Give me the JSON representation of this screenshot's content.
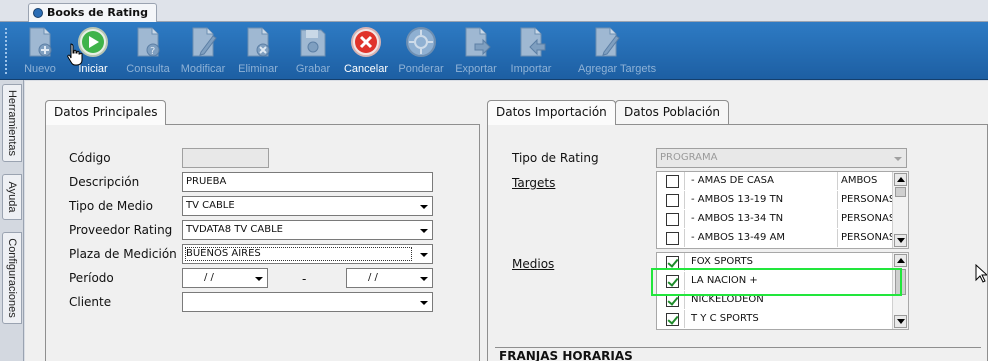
{
  "window": {
    "tab_title": "Books de Rating"
  },
  "toolbar": {
    "buttons": [
      {
        "label": "Nuevo",
        "enabled": false,
        "icon": "new-document-icon"
      },
      {
        "label": "Iniciar",
        "enabled": true,
        "icon": "play-icon"
      },
      {
        "label": "Consulta",
        "enabled": false,
        "icon": "query-document-icon"
      },
      {
        "label": "Modificar",
        "enabled": false,
        "icon": "edit-document-icon"
      },
      {
        "label": "Eliminar",
        "enabled": false,
        "icon": "delete-document-icon"
      },
      {
        "label": "Grabar",
        "enabled": false,
        "icon": "save-icon"
      },
      {
        "label": "Cancelar",
        "enabled": true,
        "icon": "cancel-icon"
      },
      {
        "label": "Ponderar",
        "enabled": false,
        "icon": "weigh-icon"
      },
      {
        "label": "Exportar",
        "enabled": false,
        "icon": "export-document-icon"
      },
      {
        "label": "Importar",
        "enabled": false,
        "icon": "import-document-icon"
      },
      {
        "label": "Agregar Targets",
        "enabled": false,
        "icon": "add-targets-icon"
      }
    ]
  },
  "side_tabs": [
    "Herramientas",
    "Ayuda",
    "Configuraciones"
  ],
  "left_panel": {
    "tab": "Datos Principales",
    "fields": {
      "codigo": {
        "label": "Código",
        "value": ""
      },
      "descripcion": {
        "label": "Descripción",
        "value": "PRUEBA"
      },
      "tipo_medio": {
        "label": "Tipo de Medio",
        "value": "TV CABLE"
      },
      "proveedor": {
        "label": "Proveedor Rating",
        "value": "TVDATA8 TV CABLE"
      },
      "plaza": {
        "label": "Plaza de Medición",
        "value": "BUENOS AIRES"
      },
      "periodo": {
        "label": "Período",
        "from": " /  /",
        "dash": "-",
        "to": " /  /"
      },
      "cliente": {
        "label": "Cliente",
        "value": ""
      }
    }
  },
  "right_panel": {
    "tabs": [
      "Datos Importación",
      "Datos Población"
    ],
    "tipo_rating": {
      "label": "Tipo de Rating",
      "value": "PROGRAMA"
    },
    "targets": {
      "label": "Targets",
      "rows": [
        {
          "name": "- AMAS DE CASA",
          "gender": "AMBOS",
          "checked": false
        },
        {
          "name": "- AMBOS 13-19 TN",
          "gender": "PERSONAS",
          "checked": false
        },
        {
          "name": "- AMBOS 13-34 TN",
          "gender": "PERSONAS",
          "checked": false
        },
        {
          "name": "- AMBOS 13-49 AM",
          "gender": "PERSONAS",
          "checked": false
        }
      ]
    },
    "medios": {
      "label": "Medios",
      "rows": [
        {
          "name": "FOX SPORTS",
          "checked": true
        },
        {
          "name": "LA NACION +",
          "checked": true
        },
        {
          "name": "NICKELODEON",
          "checked": true
        },
        {
          "name": "T Y C SPORTS",
          "checked": true
        }
      ]
    },
    "franjas_label": "FRANJAS HORARIAS"
  },
  "colors": {
    "toolbar": "#2e7bc4",
    "highlight": "#22e63c",
    "check": "#1e8b2a"
  }
}
